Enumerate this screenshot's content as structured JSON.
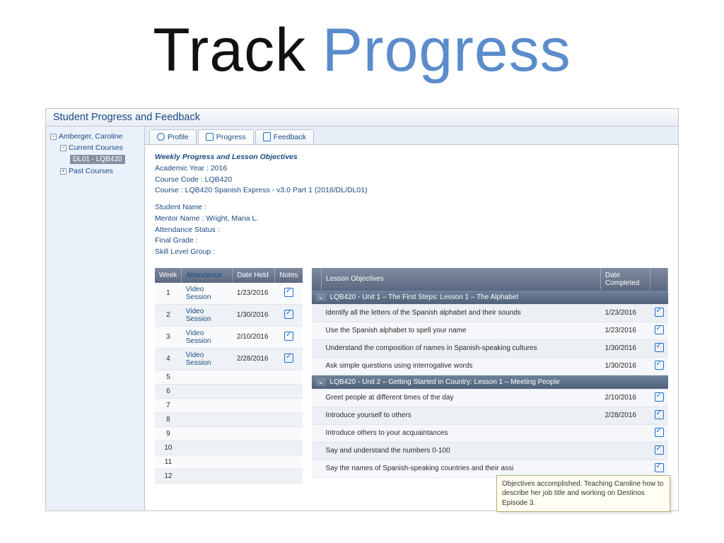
{
  "slide": {
    "word1": "Track",
    "word2": "Progress"
  },
  "window_title": "Student Progress and Feedback",
  "tree": {
    "root": "Amberger, Caroline",
    "current_label": "Current Courses",
    "current_leaf": "DL01 - LQB420",
    "past_label": "Past Courses"
  },
  "tabs": {
    "profile": "Profile",
    "progress": "Progress",
    "feedback": "Feedback"
  },
  "info": {
    "heading": "Weekly Progress and Lesson Objectives",
    "year_lbl": "Academic Year :",
    "year": "2016",
    "code_lbl": "Course Code :",
    "code": "LQB420",
    "course_lbl": "Course :",
    "course": "LQB420 Spanish Express - v3.0 Part 1 (2016/DL/DL01)",
    "student_lbl": "Student Name :",
    "mentor_lbl": "Mentor Name :",
    "mentor": "Wright, Maria L.",
    "attend_lbl": "Attendance Status :",
    "grade_lbl": "Final Grade :",
    "skill_lbl": "Skill Level Group :"
  },
  "wk_headers": {
    "week": "Week",
    "attendance": "Attendance",
    "date": "Date Held",
    "notes": "Notes"
  },
  "weeks": [
    {
      "n": "1",
      "att": "Video Session",
      "date": "1/23/2016",
      "note": true
    },
    {
      "n": "2",
      "att": "Video Session",
      "date": "1/30/2016",
      "note": true
    },
    {
      "n": "3",
      "att": "Video Session",
      "date": "2/10/2016",
      "note": true
    },
    {
      "n": "4",
      "att": "Video Session",
      "date": "2/28/2016",
      "note": true
    },
    {
      "n": "5",
      "att": "",
      "date": "",
      "note": false
    },
    {
      "n": "6",
      "att": "",
      "date": "",
      "note": false
    },
    {
      "n": "7",
      "att": "",
      "date": "",
      "note": false
    },
    {
      "n": "8",
      "att": "",
      "date": "",
      "note": false
    },
    {
      "n": "9",
      "att": "",
      "date": "",
      "note": false
    },
    {
      "n": "10",
      "att": "",
      "date": "",
      "note": false
    },
    {
      "n": "11",
      "att": "",
      "date": "",
      "note": false
    },
    {
      "n": "12",
      "att": "",
      "date": "",
      "note": false
    }
  ],
  "obj_headers": {
    "obj": "Lesson Objectives",
    "dc": "Date Completed"
  },
  "units": [
    {
      "title": "LQB420 - Unit 1 – The First Steps: Lesson 1 – The Alphabet",
      "rows": [
        {
          "text": "Identify all the letters of the Spanish alphabet and their sounds",
          "date": "1/23/2016"
        },
        {
          "text": "Use the Spanish alphabet to spell your name",
          "date": "1/23/2016"
        },
        {
          "text": "Understand the composition of names in Spanish-speaking cultures",
          "date": "1/30/2016"
        },
        {
          "text": "Ask simple questions using interrogative words",
          "date": "1/30/2016"
        }
      ]
    },
    {
      "title": "LQB420 - Unit 2 – Getting Started in Country: Lesson 1 – Meeting People",
      "rows": [
        {
          "text": "Greet people at different times of the day",
          "date": "2/10/2016"
        },
        {
          "text": "Introduce yourself to others",
          "date": "2/28/2016"
        },
        {
          "text": "Introduce others to your acquaintances",
          "date": ""
        },
        {
          "text": "Say and understand the numbers 0-100",
          "date": ""
        },
        {
          "text": "Say the names of Spanish-speaking countries and their assi",
          "date": ""
        }
      ]
    }
  ],
  "tooltip": "Objectives accomplished. Teaching Caroline how to describe her job title and working on Destinos Episode 3."
}
